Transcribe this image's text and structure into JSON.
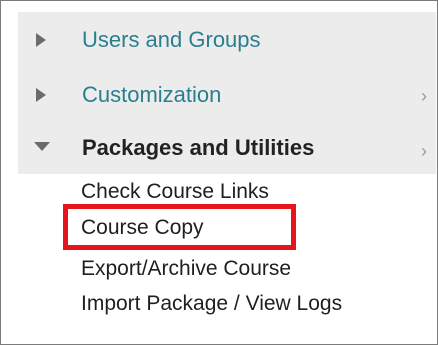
{
  "menu": {
    "sections": [
      {
        "label": "Users and Groups",
        "expanded": false,
        "has_submenu_chevron": false
      },
      {
        "label": "Customization",
        "expanded": false,
        "has_submenu_chevron": true
      },
      {
        "label": "Packages and Utilities",
        "expanded": true,
        "has_submenu_chevron": true
      }
    ],
    "chevron_glyph": "›",
    "packages_items": [
      {
        "label": "Check Course Links"
      },
      {
        "label": "Course Copy",
        "highlighted": true
      },
      {
        "label": "Export/Archive Course"
      },
      {
        "label": "Import Package / View Logs"
      }
    ]
  },
  "colors": {
    "link_teal": "#2a7f8f",
    "row_background": "#ececec",
    "highlight_red": "#e8141c",
    "active_text": "#222222"
  },
  "icons": {
    "collapsed": "triangle-right-icon",
    "expanded": "triangle-down-icon",
    "submenu": "chevron-right-icon"
  }
}
